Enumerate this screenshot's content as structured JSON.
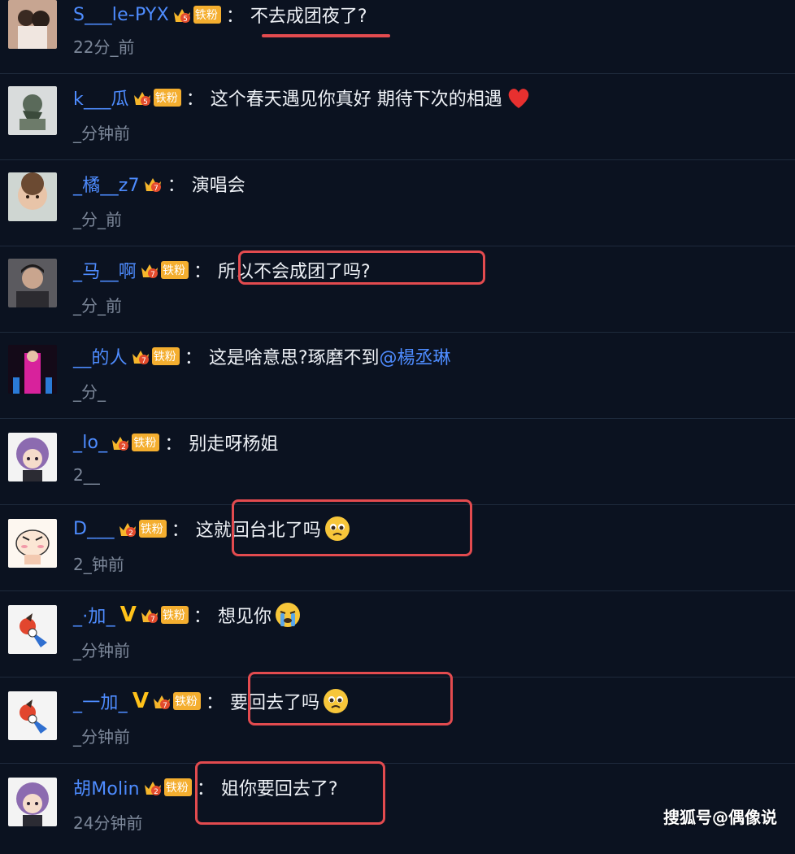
{
  "comments": [
    {
      "username": "S___le-PYX",
      "fan_level": "5",
      "fan_label": "铁粉",
      "colon": "：",
      "text": "不去成团夜了?",
      "time": "22分_前"
    },
    {
      "username": "k___瓜",
      "fan_level": "5",
      "fan_label": "铁粉",
      "colon": "：",
      "text": "这个春天遇见你真好 期待下次的相遇",
      "time": "_分钟前"
    },
    {
      "username": "_橘__z7",
      "fan_level": "7",
      "colon": "：",
      "text": "演唱会",
      "time": "_分_前"
    },
    {
      "username": "_马__啊",
      "fan_level": "7",
      "fan_label": "铁粉",
      "colon": "：",
      "text": "所以不会成团了吗?",
      "time": "_分_前"
    },
    {
      "username": "__的人",
      "fan_level": "7",
      "fan_label": "铁粉",
      "colon": "：",
      "text": "这是啥意思?琢磨不到",
      "mention": "@楊丞琳",
      "time": "_分_"
    },
    {
      "username": "_lo_",
      "fan_level": "2",
      "fan_label": "铁粉",
      "colon": "：",
      "text": "别走呀杨姐",
      "time": "2__"
    },
    {
      "username": "D___",
      "fan_level": "2",
      "fan_label": "铁粉",
      "colon": "：",
      "text": "这就回台北了吗",
      "time": "2_钟前"
    },
    {
      "username": "_·加_",
      "vip": "V",
      "fan_level": "7",
      "fan_label": "铁粉",
      "colon": "：",
      "text": "想见你",
      "time": "_分钟前"
    },
    {
      "username": "_一加_",
      "vip": "V",
      "fan_level": "7",
      "fan_label": "铁粉",
      "colon": "：",
      "text": "要回去了吗",
      "time": "_分钟前"
    },
    {
      "username": "胡Molin",
      "fan_level": "2",
      "fan_label": "铁粉",
      "colon": "：",
      "text": "姐你要回去了?",
      "time": "24分钟前"
    }
  ],
  "watermark": "搜狐号@偶像说",
  "colors": {
    "background": "#0b1220",
    "username": "#4e8cff",
    "text": "#eef1f6",
    "time": "#7c8799",
    "highlight": "#e34b4f",
    "fan_badge": "#f4ae2f"
  }
}
